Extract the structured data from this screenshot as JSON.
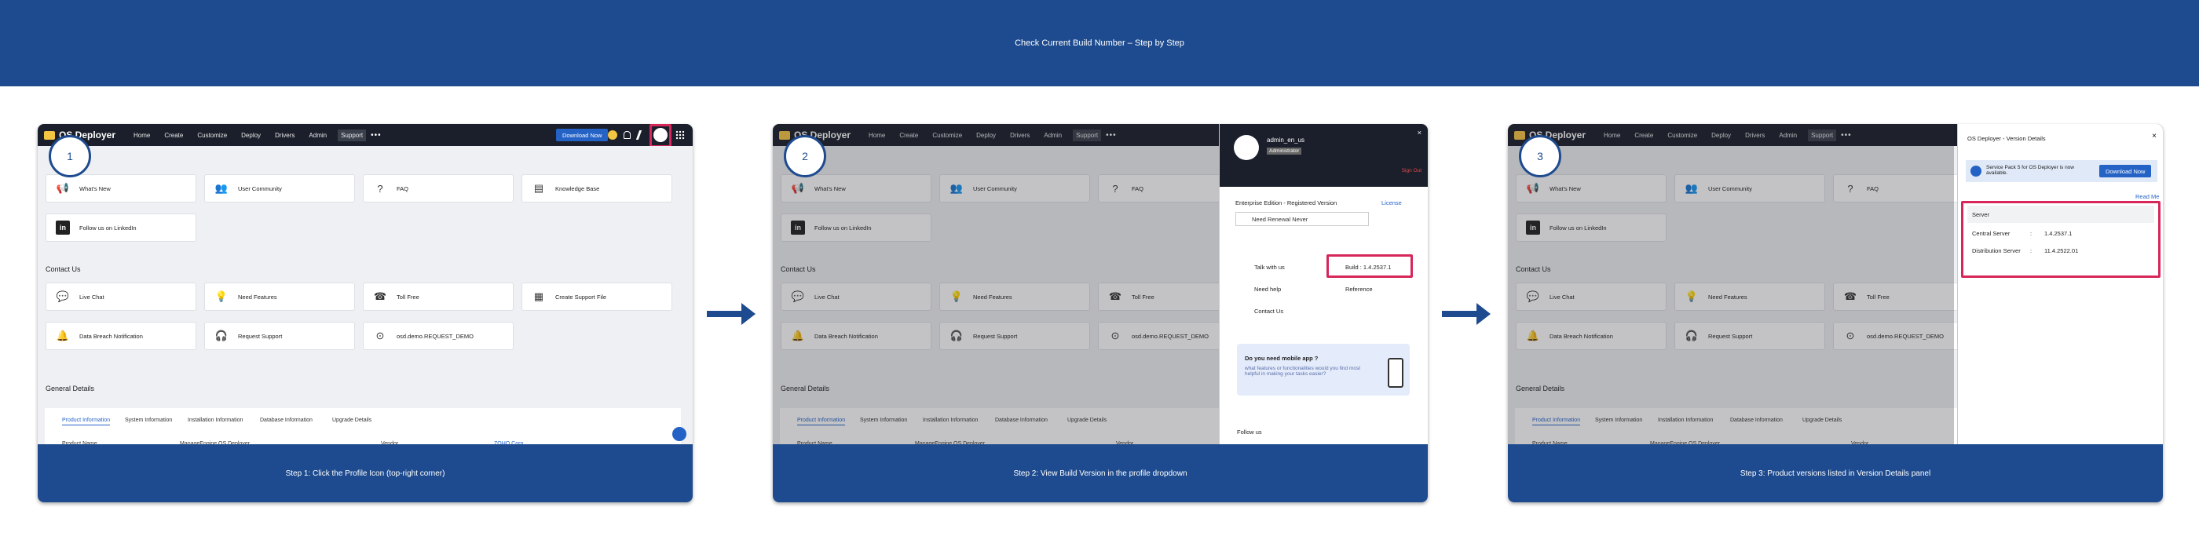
{
  "banner": {
    "title": "Check Current Build Number – Step by Step"
  },
  "app": {
    "name": "OS Deployer",
    "nav": [
      "Home",
      "Create",
      "Customize",
      "Deploy",
      "Drivers",
      "Admin",
      "Support"
    ],
    "more": "•••",
    "download_now": "Download Now"
  },
  "support": {
    "resources": [
      "What's New",
      "User Community",
      "FAQ",
      "Knowledge Base"
    ],
    "linkedin": "Follow us on LinkedIn",
    "contact_heading": "Contact Us",
    "contact": [
      "Live Chat",
      "Need Features",
      "Toll Free",
      "Create Support File"
    ],
    "contact2": [
      "Data Breach Notification",
      "Request Support",
      "osd.demo.REQUEST_DEMO"
    ],
    "general_heading": "General Details",
    "tabs": [
      "Product Information",
      "System Information",
      "Installation Information",
      "Database Information",
      "Upgrade Details"
    ],
    "table_headers": [
      "Product Name",
      "ManageEngine OS Deployer",
      "Vendor",
      "ZOHO Corp"
    ]
  },
  "steps": [
    {
      "number": "1",
      "caption": "Step 1: Click the Profile Icon (top-right corner)"
    },
    {
      "number": "2",
      "caption": "Step 2: View Build Version in the profile dropdown"
    },
    {
      "number": "3",
      "caption": "Step 3: Product versions listed in Version Details panel"
    }
  ],
  "profile": {
    "user": "admin_en_us",
    "role": "Administrator",
    "sign_out": "Sign Out",
    "edition": "Enterprise Edition - Registered Version",
    "license": "License",
    "renewal": "Need Renewal Never",
    "talk": "Talk with us",
    "build": "Build : 1.4.2537.1",
    "help": "Need help",
    "reference": "Reference",
    "contact": "Contact Us",
    "mobile_title": "Do you need mobile app ?",
    "mobile_text": "what features or functionalities would you find most helpful in making your tasks easier?",
    "follow": "Follow us"
  },
  "version": {
    "title": "OS Deployer - Version Details",
    "notice": "Service Pack 5 for OS Deployer is now available.",
    "download": "Download Now",
    "read_me": "Read Me",
    "server_header": "Server",
    "rows": [
      {
        "name": "Central Server",
        "value": "1.4.2537.1"
      },
      {
        "name": "Distribution Server",
        "value": "11.4.2522.01"
      }
    ]
  }
}
